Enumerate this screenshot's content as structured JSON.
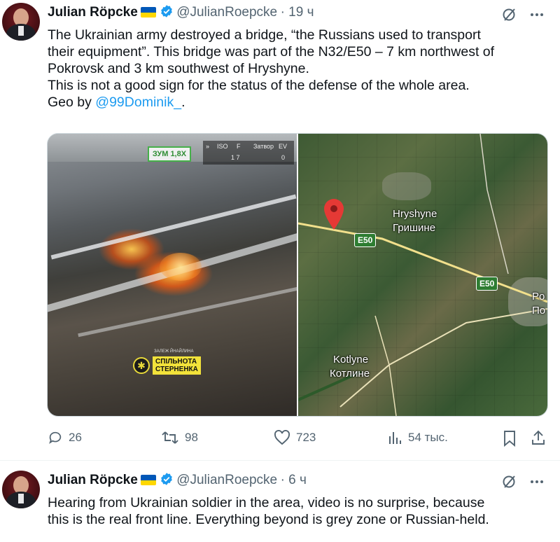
{
  "tweet1": {
    "author_name": "Julian Röpcke",
    "handle": "@JulianRoepcke",
    "time": "· 19 ч",
    "text_lines": [
      "The Ukrainian army destroyed a bridge, “the Russians used to transport",
      "their equipment”. This bridge was part of the N32/E50 – 7 km northwest of",
      "Pokrovsk and 3 km southwest of Hryshyne.",
      "This is not a good sign for the status of the defense of the whole area."
    ],
    "geo_prefix": "Geo by ",
    "geo_link": "@99Dominik_",
    "geo_suffix": ".",
    "video": {
      "zoom_label": "ЗУМ 1,8X",
      "hud_labels": [
        "ISO",
        "F",
        "Затвор",
        "EV"
      ],
      "hud_values": [
        "1 7",
        "0"
      ],
      "badge_small": "ЗАЛЕЖ ЙНАЙЛИНА",
      "badge_line1": "СПІЛЬНОТА",
      "badge_line2": "СТЕРНЕНКА"
    },
    "map": {
      "place1_latin": "Hryshyne",
      "place1_cyr": "Гришине",
      "place2_latin": "Kotlyne",
      "place2_cyr": "Котлине",
      "road_label": "E50",
      "edge_label1": "Po",
      "edge_label2": "По"
    },
    "actions": {
      "replies": "26",
      "reposts": "98",
      "likes": "723",
      "views": "54 тыс."
    }
  },
  "tweet2": {
    "author_name": "Julian Röpcke",
    "handle": "@JulianRoepcke",
    "time": "· 6 ч",
    "text_lines": [
      "Hearing from Ukrainian soldier in the area, video is no surprise, because",
      "this is the real front line. Everything beyond is grey zone or Russian-held."
    ]
  },
  "colors": {
    "verified": "#1d9bf0",
    "link": "#1d9bf0",
    "flag_blue": "#0057b7",
    "flag_yellow": "#ffd700"
  },
  "icons": [
    "grok-slash-icon",
    "more-icon",
    "reply-icon",
    "repost-icon",
    "like-icon",
    "views-icon",
    "bookmark-icon",
    "share-icon",
    "map-pin-icon"
  ]
}
